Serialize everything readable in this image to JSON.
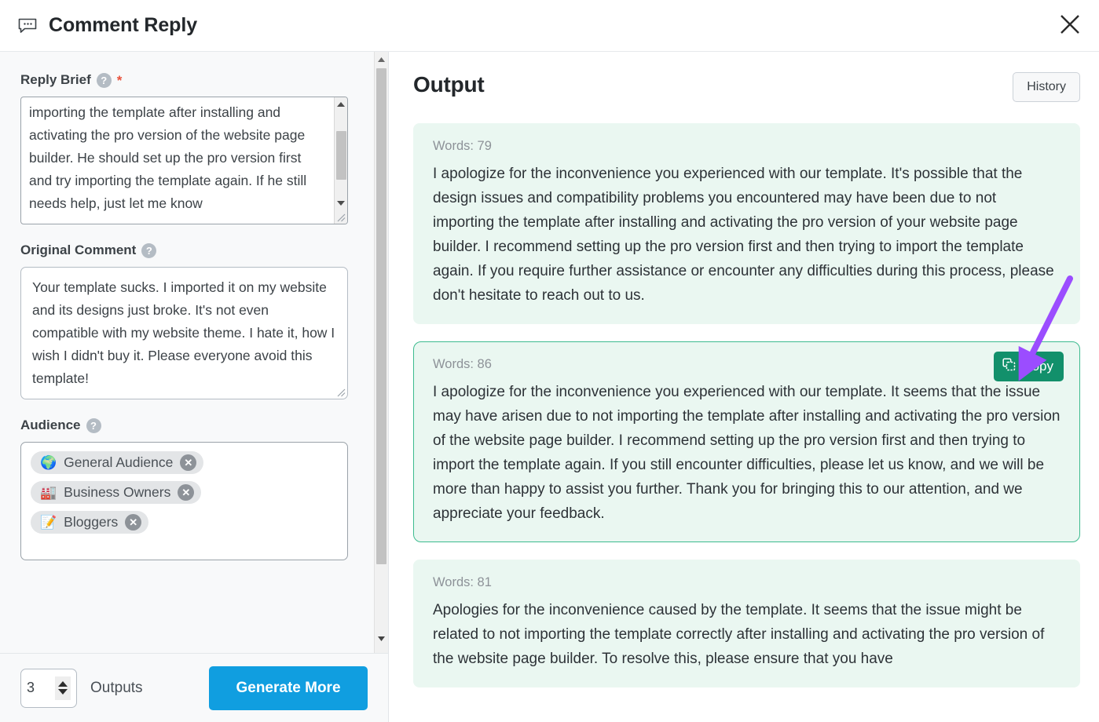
{
  "header": {
    "icon": "comment-bubble-icon",
    "title": "Comment Reply",
    "close_label": "✕"
  },
  "left_panel": {
    "reply_brief": {
      "label": "Reply Brief",
      "help_icon": "question-circle-icon",
      "required_mark": "*",
      "value": "importing the template after installing and activating the pro version of the website page builder. He should set up the pro version first and try importing the template again. If he still needs help, just let me know"
    },
    "original_comment": {
      "label": "Original Comment",
      "help_icon": "question-circle-icon",
      "value": "Your template sucks. I imported it on my website and its designs just broke. It's not even compatible with my website theme. I hate it, how I wish I didn't buy it. Please everyone avoid this template!"
    },
    "audience": {
      "label": "Audience",
      "help_icon": "question-circle-icon",
      "chips": [
        {
          "emoji": "🌍",
          "emoji_name": "globe-icon",
          "label": "General Audience",
          "remove": "✕"
        },
        {
          "emoji": "🏭",
          "emoji_name": "factory-icon",
          "label": "Business Owners",
          "remove": "✕"
        },
        {
          "emoji": "📝",
          "emoji_name": "memo-icon",
          "label": "Bloggers",
          "remove": "✕"
        }
      ]
    },
    "footer": {
      "outputs_count": "3",
      "outputs_label": "Outputs",
      "generate_label": "Generate More"
    }
  },
  "right_panel": {
    "title": "Output",
    "history_label": "History",
    "copy_label": "Copy",
    "copy_icon": "copy-icon",
    "cards": [
      {
        "words_label": "Words: 79",
        "text": "I apologize for the inconvenience you experienced with our template. It's possible that the design issues and compatibility problems you encountered may have been due to not importing the template after installing and activating the pro version of your website page builder. I recommend setting up the pro version first and then trying to import the template again. If you require further assistance or encounter any difficulties during this process, please don't hesitate to reach out to us.",
        "selected": false
      },
      {
        "words_label": "Words: 86",
        "text": "I apologize for the inconvenience you experienced with our template. It seems that the issue may have arisen due to not importing the template after installing and activating the pro version of the website page builder. I recommend setting up the pro version first and then trying to import the template again. If you still encounter difficulties, please let us know, and we will be more than happy to assist you further. Thank you for bringing this to our attention, and we appreciate your feedback.",
        "selected": true
      },
      {
        "words_label": "Words: 81",
        "text": "Apologies for the inconvenience caused by the template. It seems that the issue might be related to not importing the template correctly after installing and activating the pro version of the website page builder. To resolve this, please ensure that you have",
        "selected": false
      }
    ]
  },
  "annotation": {
    "arrow_color": "#9b4dff",
    "points_to": "copy-button"
  },
  "colors": {
    "primary_button": "#109ee0",
    "copy_button": "#12906b",
    "card_background": "#eaf7f1",
    "card_border_selected": "#3dbb8f",
    "required_star": "#e8503a"
  }
}
